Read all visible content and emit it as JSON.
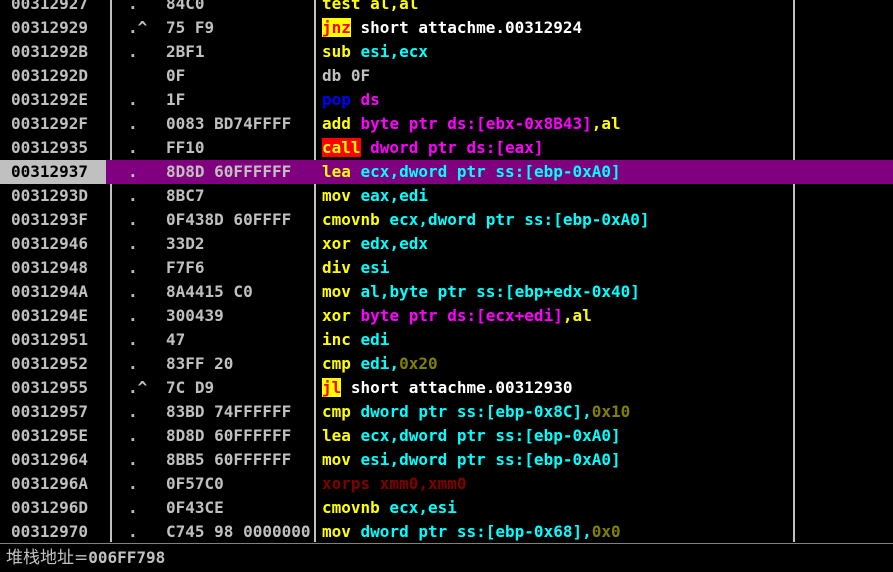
{
  "colors": {
    "background": "#000000",
    "address": "#c0c0c0",
    "selected_row_bg": "#800080",
    "selected_address_bg": "#c0c0c0",
    "selected_address_fg": "#000000"
  },
  "rows": [
    {
      "addr": "00312927",
      "flag": ".",
      "hex": "84C0",
      "tokens": [
        {
          "t": "test",
          "c": "#ffff00"
        },
        {
          "t": " al,al",
          "c": "#ffff00"
        }
      ]
    },
    {
      "addr": "00312929",
      "flag": ".^",
      "hex": "75 F9",
      "tokens": [
        {
          "t": "jnz",
          "c": "#ff0000",
          "bg": "#ffff00"
        },
        {
          "t": " short attachme.00312924",
          "c": "#ffffff"
        }
      ]
    },
    {
      "addr": "0031292B",
      "flag": ".",
      "hex": "2BF1",
      "tokens": [
        {
          "t": "sub",
          "c": "#ffff00"
        },
        {
          "t": " esi,ecx",
          "c": "#00ffff"
        }
      ]
    },
    {
      "addr": "0031292D",
      "flag": "",
      "hex": "0F",
      "tokens": [
        {
          "t": "db 0F",
          "c": "#c0c0c0"
        }
      ]
    },
    {
      "addr": "0031292E",
      "flag": ".",
      "hex": "1F",
      "tokens": [
        {
          "t": "pop",
          "c": "#0000ff"
        },
        {
          "t": " ds",
          "c": "#ff00ff"
        }
      ]
    },
    {
      "addr": "0031292F",
      "flag": ".",
      "hex": "0083 BD74FFFF",
      "tokens": [
        {
          "t": "add",
          "c": "#ffff00"
        },
        {
          "t": " byte ptr ds:[ebx-0x8B43]",
          "c": "#ff00ff"
        },
        {
          "t": ",al",
          "c": "#ffff00"
        }
      ]
    },
    {
      "addr": "00312935",
      "flag": ".",
      "hex": "FF10",
      "tokens": [
        {
          "t": "call",
          "c": "#ffff00",
          "bg": "#ff0000"
        },
        {
          "t": " dword ptr ds:[eax]",
          "c": "#ff00ff"
        }
      ]
    },
    {
      "addr": "00312937",
      "flag": ".",
      "hex": "8D8D 60FFFFFF",
      "selected": true,
      "tokens": [
        {
          "t": "lea",
          "c": "#ffff00"
        },
        {
          "t": " ecx,",
          "c": "#00ffff"
        },
        {
          "t": "dword ptr ss:[ebp-0xA0]",
          "c": "#00ffff"
        }
      ]
    },
    {
      "addr": "0031293D",
      "flag": ".",
      "hex": "8BC7",
      "tokens": [
        {
          "t": "mov",
          "c": "#ffff00"
        },
        {
          "t": " eax,edi",
          "c": "#00ffff"
        }
      ]
    },
    {
      "addr": "0031293F",
      "flag": ".",
      "hex": "0F438D 60FFFF",
      "tokens": [
        {
          "t": "cmovnb",
          "c": "#ffff00"
        },
        {
          "t": " ecx,dword ptr ss:[ebp-0xA0]",
          "c": "#00ffff"
        }
      ]
    },
    {
      "addr": "00312946",
      "flag": ".",
      "hex": "33D2",
      "tokens": [
        {
          "t": "xor",
          "c": "#ffff00"
        },
        {
          "t": " edx,edx",
          "c": "#00ffff"
        }
      ]
    },
    {
      "addr": "00312948",
      "flag": ".",
      "hex": "F7F6",
      "tokens": [
        {
          "t": "div",
          "c": "#ffff00"
        },
        {
          "t": " esi",
          "c": "#00ffff"
        }
      ]
    },
    {
      "addr": "0031294A",
      "flag": ".",
      "hex": "8A4415 C0",
      "tokens": [
        {
          "t": "mov",
          "c": "#ffff00"
        },
        {
          "t": " al,byte ptr ss:[ebp+edx-0x40]",
          "c": "#00ffff"
        }
      ]
    },
    {
      "addr": "0031294E",
      "flag": ".",
      "hex": "300439",
      "tokens": [
        {
          "t": "xor",
          "c": "#ffff00"
        },
        {
          "t": " byte ptr ds:[ecx+edi]",
          "c": "#ff00ff"
        },
        {
          "t": ",al",
          "c": "#ffff00"
        }
      ]
    },
    {
      "addr": "00312951",
      "flag": ".",
      "hex": "47",
      "tokens": [
        {
          "t": "inc",
          "c": "#ffff00"
        },
        {
          "t": " edi",
          "c": "#00ffff"
        }
      ]
    },
    {
      "addr": "00312952",
      "flag": ".",
      "hex": "83FF 20",
      "tokens": [
        {
          "t": "cmp",
          "c": "#ffff00"
        },
        {
          "t": " edi,",
          "c": "#00ffff"
        },
        {
          "t": "0x20",
          "c": "#808000"
        }
      ]
    },
    {
      "addr": "00312955",
      "flag": ".^",
      "hex": "7C D9",
      "tokens": [
        {
          "t": "jl",
          "c": "#ff0000",
          "bg": "#ffff00"
        },
        {
          "t": " short attachme.00312930",
          "c": "#ffffff"
        }
      ]
    },
    {
      "addr": "00312957",
      "flag": ".",
      "hex": "83BD 74FFFFFF",
      "tokens": [
        {
          "t": "cmp",
          "c": "#ffff00"
        },
        {
          "t": " dword ptr ss:[ebp-0x8C]",
          "c": "#00ffff"
        },
        {
          "t": ",",
          "c": "#00ffff"
        },
        {
          "t": "0x10",
          "c": "#808000"
        }
      ]
    },
    {
      "addr": "0031295E",
      "flag": ".",
      "hex": "8D8D 60FFFFFF",
      "tokens": [
        {
          "t": "lea",
          "c": "#ffff00"
        },
        {
          "t": " ecx,dword ptr ss:[ebp-0xA0]",
          "c": "#00ffff"
        }
      ]
    },
    {
      "addr": "00312964",
      "flag": ".",
      "hex": "8BB5 60FFFFFF",
      "tokens": [
        {
          "t": "mov",
          "c": "#ffff00"
        },
        {
          "t": " esi,dword ptr ss:[ebp-0xA0]",
          "c": "#00ffff"
        }
      ]
    },
    {
      "addr": "0031296A",
      "flag": ".",
      "hex": "0F57C0",
      "tokens": [
        {
          "t": "xorps xmm0,xmm0",
          "c": "#800000"
        }
      ]
    },
    {
      "addr": "0031296D",
      "flag": ".",
      "hex": "0F43CE",
      "tokens": [
        {
          "t": "cmovnb",
          "c": "#ffff00"
        },
        {
          "t": " ecx,esi",
          "c": "#00ffff"
        }
      ]
    },
    {
      "addr": "00312970",
      "flag": ".",
      "hex": "C745 98 0000000",
      "tokens": [
        {
          "t": "mov",
          "c": "#ffff00"
        },
        {
          "t": " dword ptr ss:[ebp-0x68]",
          "c": "#00ffff"
        },
        {
          "t": ",",
          "c": "#00ffff"
        },
        {
          "t": "0x0",
          "c": "#808000"
        }
      ]
    }
  ],
  "status": {
    "label": "堆栈地址=",
    "value": "006FF798"
  }
}
